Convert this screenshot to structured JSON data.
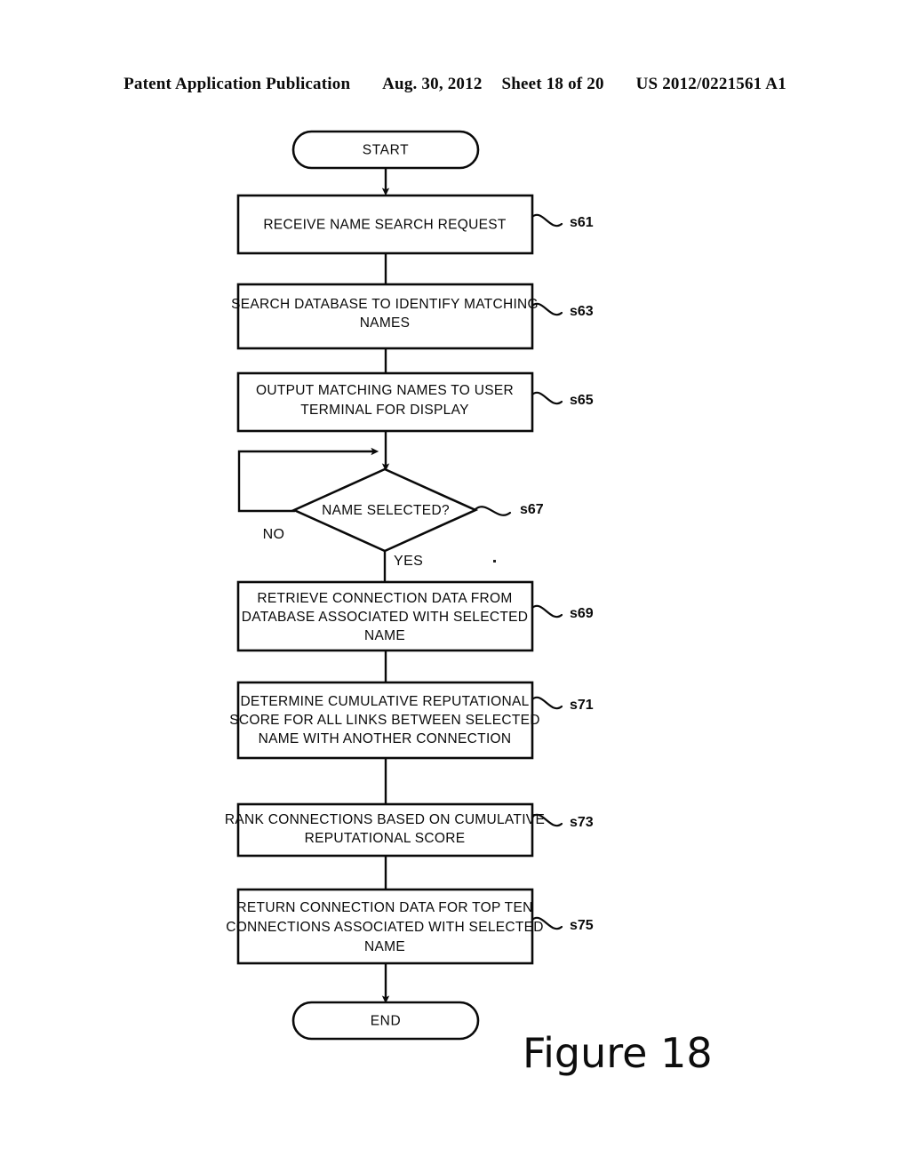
{
  "header": {
    "publication": "Patent Application Publication",
    "date": "Aug. 30, 2012",
    "sheet": "Sheet 18 of 20",
    "patent_number": "US 2012/0221561 A1"
  },
  "figure": {
    "caption": "Figure 18"
  },
  "flowchart": {
    "start_label": "START",
    "end_label": "END",
    "branch_yes": "YES",
    "branch_no": "NO",
    "decision": {
      "text": "NAME SELECTED?",
      "ref": "s67"
    },
    "steps": [
      {
        "ref": "s61",
        "lines": [
          "RECEIVE NAME SEARCH REQUEST"
        ]
      },
      {
        "ref": "s63",
        "lines": [
          "SEARCH DATABASE TO IDENTIFY MATCHING",
          "NAMES"
        ]
      },
      {
        "ref": "s65",
        "lines": [
          "OUTPUT MATCHING NAMES TO USER",
          "TERMINAL FOR DISPLAY"
        ]
      },
      {
        "ref": "s69",
        "lines": [
          "RETRIEVE CONNECTION DATA FROM",
          "DATABASE ASSOCIATED WITH SELECTED",
          "NAME"
        ]
      },
      {
        "ref": "s71",
        "lines": [
          "DETERMINE CUMULATIVE REPUTATIONAL",
          "SCORE FOR ALL LINKS BETWEEN SELECTED",
          "NAME WITH ANOTHER CONNECTION"
        ]
      },
      {
        "ref": "s73",
        "lines": [
          "RANK CONNECTIONS BASED ON CUMULATIVE",
          "REPUTATIONAL SCORE"
        ]
      },
      {
        "ref": "s75",
        "lines": [
          "RETURN CONNECTION DATA FOR TOP TEN",
          "CONNECTIONS ASSOCIATED WITH SELECTED",
          "NAME"
        ]
      }
    ]
  },
  "colors": {
    "ink": "#0a0a0a",
    "page": "#ffffff"
  }
}
